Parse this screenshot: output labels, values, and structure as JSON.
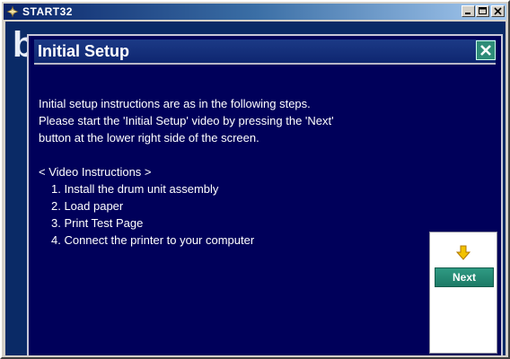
{
  "window": {
    "title": "START32",
    "icon": "app-icon",
    "buttons": [
      "minimize",
      "maximize",
      "close"
    ]
  },
  "background_letter": "b",
  "dialog": {
    "title": "Initial Setup",
    "close_icon": "close-icon",
    "intro_lines": [
      "Initial setup instructions are as in the following steps.",
      "Please start the 'Initial Setup' video by pressing the 'Next'",
      "button at the lower right side of the screen."
    ],
    "instructions_header": "< Video Instructions >",
    "steps": [
      "1.  Install the drum unit assembly",
      "2.  Load paper",
      "3.  Print Test Page",
      "4.  Connect the printer to your computer"
    ]
  },
  "next_panel": {
    "arrow_icon": "down-arrow-icon",
    "next_label": "Next"
  },
  "colors": {
    "dialog_bg": "#00005a",
    "next_button": "#2f9a83",
    "arrow": "#f2c200"
  }
}
